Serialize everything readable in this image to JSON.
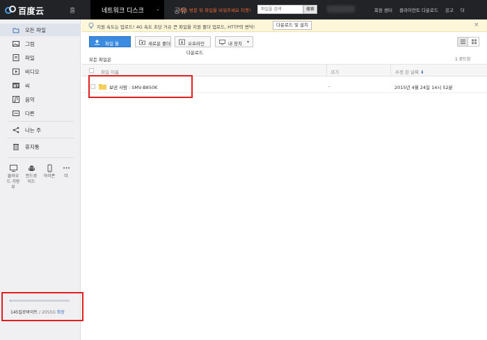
{
  "header": {
    "logo_text": "百度云",
    "nav": {
      "home": "홈",
      "disk": "네트워크 디스크",
      "share": "공유"
    },
    "promo": "배송 방문 뒤 파일을 비워주세요 티켓!",
    "search": {
      "placeholder": "파일을 검색",
      "button": "搜索"
    },
    "links": [
      "회원 센터",
      "클라이언트 다운로드",
      "공고",
      "더"
    ]
  },
  "sidebar": {
    "items": [
      {
        "label": "모든 파일",
        "icon": "folder-icon"
      },
      {
        "label": "그림",
        "icon": "image-icon"
      },
      {
        "label": "파일",
        "icon": "document-icon"
      },
      {
        "label": "비디오",
        "icon": "video-icon"
      },
      {
        "label": "씨",
        "icon": "bt-icon"
      },
      {
        "label": "음악",
        "icon": "music-icon"
      },
      {
        "label": "다른",
        "icon": "more-icon"
      }
    ],
    "share": {
      "label": "나는 주",
      "icon": "share-icon"
    },
    "trash": {
      "label": "휴지통",
      "icon": "trash-icon"
    },
    "devices": [
      {
        "label": "클라우드 가방 부",
        "icon": "monitor-icon"
      },
      {
        "label": "안드로이드",
        "icon": "android-icon"
      },
      {
        "label": "아이폰",
        "icon": "phone-icon"
      },
      {
        "label": "더",
        "icon": "more-icon"
      }
    ],
    "quota": {
      "used": "145킬로바이트",
      "separator": "/",
      "total": "2055G",
      "link": "확장",
      "used_fraction": 0.01
    }
  },
  "notice": {
    "text": "지원 속도는 업로드! 4G 속도 초당 거슈 큰 파일을 지원 폴더 업로드, HTTP의 변덕!",
    "button": "다운로드 및 설치"
  },
  "toolbar": {
    "upload": "파일 올",
    "new_folder": "새로운 폴더",
    "offline": "오프라인",
    "offline_sub": "다운로드",
    "my_device": "내 장치"
  },
  "breadcrumb": "모든 파일은",
  "loaded_count": "1 로드된",
  "table": {
    "headers": {
      "name": "파일 이름",
      "size": "크기",
      "date": "수정 된 날짜"
    },
    "rows": [
      {
        "name": "보낸 사람 : SMV-B850K",
        "size": "-",
        "date": "2015년 4월 24일 14시 52분"
      }
    ]
  },
  "colors": {
    "accent": "#3b8ce0",
    "highlight": "#e02020",
    "topbar": "#222326"
  }
}
